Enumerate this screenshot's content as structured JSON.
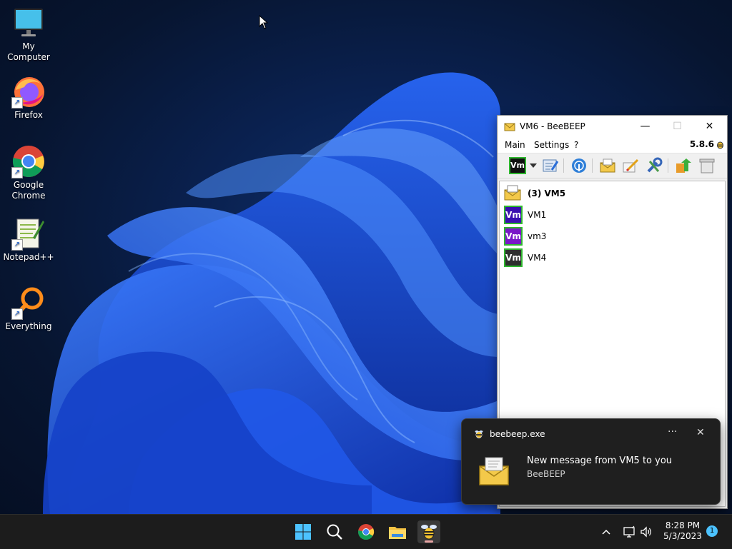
{
  "desktop": {
    "icons": [
      {
        "label": "My Computer",
        "icon": "monitor-icon"
      },
      {
        "label": "Firefox",
        "icon": "firefox-icon"
      },
      {
        "label_line1": "Google",
        "label_line2": "Chrome",
        "icon": "chrome-icon"
      },
      {
        "label": "Notepad++",
        "icon": "notepadpp-icon"
      },
      {
        "label": "Everything",
        "icon": "everything-search-icon"
      }
    ]
  },
  "beebeep": {
    "title": "VM6 - BeeBEEP",
    "menu": [
      "Main",
      "Settings",
      "?"
    ],
    "version": "5.8.6",
    "toolbar": {
      "status_avatar_text": "Vm",
      "icons": [
        "status-icon",
        "edit-profile-icon",
        "network-icon",
        "messages-icon",
        "write-message-icon",
        "tools-icon",
        "share-icon",
        "trash-icon"
      ]
    },
    "users": [
      {
        "name": "(3) VM5",
        "bold": true,
        "icon": "envelope-icon"
      },
      {
        "name": "VM1",
        "avatar": "Vm",
        "color": "#3a0fb0"
      },
      {
        "name": "vm3",
        "avatar": "Vm",
        "color": "#7a16c8"
      },
      {
        "name": "VM4",
        "avatar": "Vm",
        "color": "#2e2e2e"
      }
    ]
  },
  "toast": {
    "app": "beebeep.exe",
    "more": "···",
    "close": "✕",
    "message": "New message from VM5 to you",
    "source": "BeeBEEP"
  },
  "taskbar": {
    "apps": [
      "start-icon",
      "search-icon",
      "chrome-icon",
      "file-explorer-icon",
      "beebeep-icon"
    ],
    "time": "8:28 PM",
    "date": "5/3/2023",
    "notifications": "1"
  },
  "colors": {
    "vm_border": "#2fb62f",
    "taskbar": "#1c1c1c",
    "toast_bg": "#1f1f1f",
    "accent": "#4cc2ff"
  }
}
